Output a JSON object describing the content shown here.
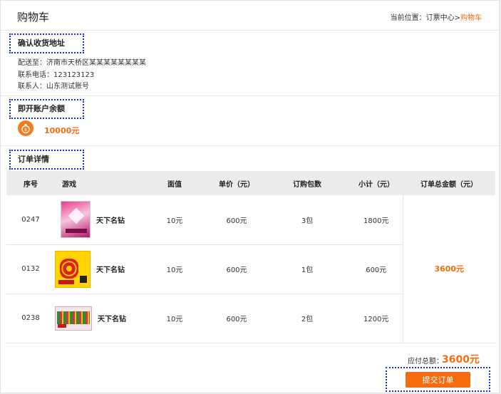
{
  "header": {
    "title": "购物车",
    "breadcrumb_prefix": "当前位置：",
    "breadcrumb_parent": "订票中心",
    "breadcrumb_sep": ">",
    "breadcrumb_current": "购物车"
  },
  "address": {
    "heading": "确认收货地址",
    "ship_to": "配送至：济南市天桥区某某某某某某某某",
    "phone": "联系电话：123123123",
    "contact": "联系人：山东测试账号"
  },
  "balance": {
    "heading": "即开账户余额",
    "amount": "10000元",
    "icon": "coin-bag-icon"
  },
  "order": {
    "heading": "订单详情",
    "columns": [
      "序号",
      "游戏",
      "面值",
      "单价（元）",
      "订购包数",
      "小计（元）",
      "订单总金额（元）"
    ],
    "rows": [
      {
        "id": "0247",
        "game": "天下名钻",
        "face": "10元",
        "price": "600元",
        "qty": "3包",
        "subtotal": "1800元"
      },
      {
        "id": "0132",
        "game": "天下名钻",
        "face": "10元",
        "price": "600元",
        "qty": "1包",
        "subtotal": "600元"
      },
      {
        "id": "0238",
        "game": "天下名钻",
        "face": "10元",
        "price": "600元",
        "qty": "2包",
        "subtotal": "1200元"
      }
    ],
    "grand_total": "3600元"
  },
  "footer": {
    "payable_label": "应付总额：",
    "payable_amount": "3600元",
    "submit_label": "提交订单"
  },
  "colors": {
    "accent": "#f26d10",
    "button": "#f66a10",
    "focus_outline": "#1a2fd6"
  }
}
